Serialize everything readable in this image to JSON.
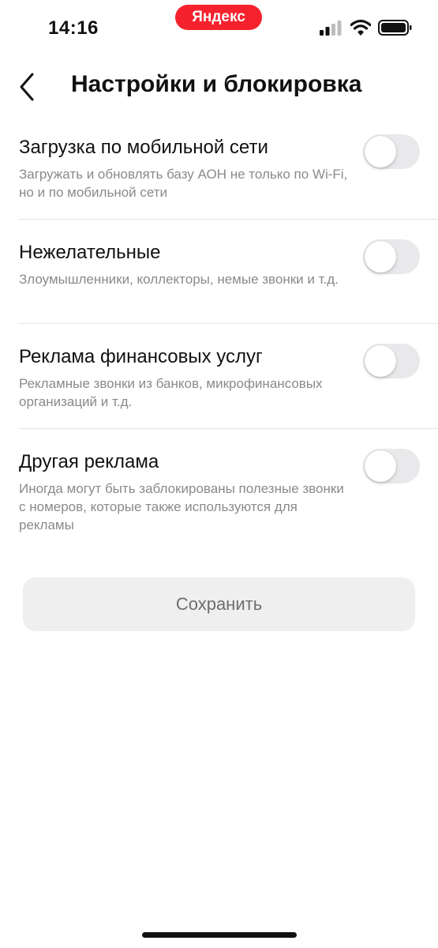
{
  "status_bar": {
    "time": "14:16",
    "brand": "Яндекс",
    "brand_color": "#f5222d",
    "icons": [
      "signal-icon",
      "wifi-icon",
      "battery-icon"
    ]
  },
  "header": {
    "back_icon": "chevron-left-icon",
    "title": "Настройки и блокировка"
  },
  "settings": [
    {
      "title": "Загрузка по мобильной сети",
      "description": "Загружать и обновлять базу АОН не только по Wi-Fi, но и по мобильной сети",
      "enabled": false
    },
    {
      "title": "Нежелательные",
      "description": "Злоумышленники, коллекторы, немые звонки и т.д.",
      "enabled": false
    },
    {
      "title": "Реклама финансовых услуг",
      "description": "Рекламные звонки из банков, микрофинансовых организаций и т.д.",
      "enabled": false
    },
    {
      "title": "Другая реклама",
      "description": "Иногда могут быть заблокированы полезные звонки с номеров, которые также используются для рекламы",
      "enabled": false
    }
  ],
  "save_button": {
    "label": "Сохранить"
  }
}
